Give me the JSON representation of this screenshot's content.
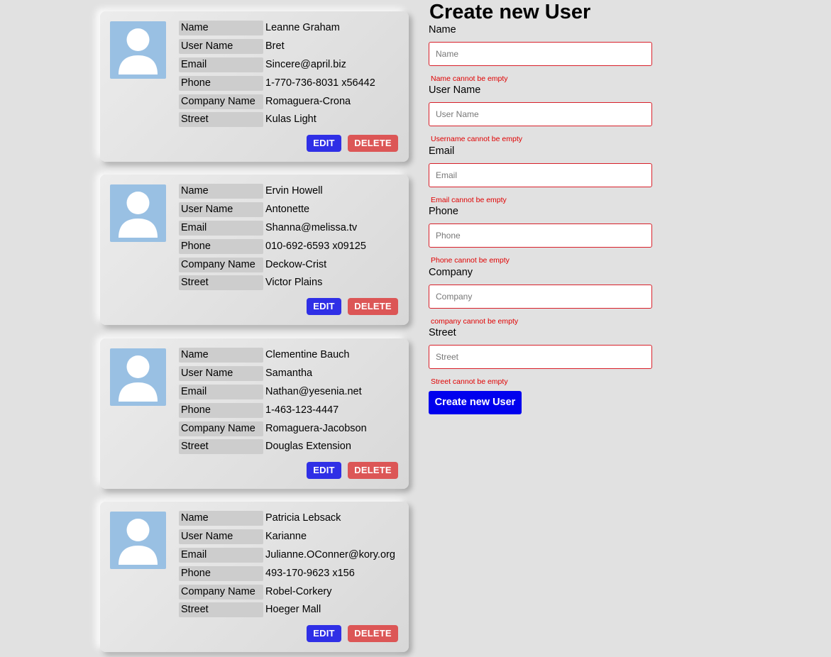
{
  "labels": {
    "name": "Name",
    "username": "User Name",
    "email": "Email",
    "phone": "Phone",
    "company": "Company Name",
    "street": "Street",
    "edit": "EDIT",
    "delete": "DELETE"
  },
  "users": [
    {
      "name": "Leanne Graham",
      "username": "Bret",
      "email": "Sincere@april.biz",
      "phone": "1-770-736-8031 x56442",
      "company": "Romaguera-Crona",
      "street": "Kulas Light"
    },
    {
      "name": "Ervin Howell",
      "username": "Antonette",
      "email": "Shanna@melissa.tv",
      "phone": "010-692-6593 x09125",
      "company": "Deckow-Crist",
      "street": "Victor Plains"
    },
    {
      "name": "Clementine Bauch",
      "username": "Samantha",
      "email": "Nathan@yesenia.net",
      "phone": "1-463-123-4447",
      "company": "Romaguera-Jacobson",
      "street": "Douglas Extension"
    },
    {
      "name": "Patricia Lebsack",
      "username": "Karianne",
      "email": "Julianne.OConner@kory.org",
      "phone": "493-170-9623 x156",
      "company": "Robel-Corkery",
      "street": "Hoeger Mall"
    }
  ],
  "form": {
    "title": "Create new User",
    "fields": [
      {
        "label": "Name",
        "placeholder": "Name",
        "value": "",
        "error": "Name cannot be empty"
      },
      {
        "label": "User Name",
        "placeholder": "User Name",
        "value": "",
        "error": "Username cannot be empty"
      },
      {
        "label": "Email",
        "placeholder": "Email",
        "value": "",
        "error": "Email cannot be empty"
      },
      {
        "label": "Phone",
        "placeholder": "Phone",
        "value": "",
        "error": "Phone cannot be empty"
      },
      {
        "label": "Company",
        "placeholder": "Company",
        "value": "",
        "error": "company cannot be empty"
      },
      {
        "label": "Street",
        "placeholder": "Street",
        "value": "",
        "error": "Street cannot be empty"
      }
    ],
    "submit_label": "Create new User"
  },
  "icons": {
    "avatar": "user-avatar-icon"
  },
  "colors": {
    "edit_button": "#2f2fe6",
    "delete_button": "#dc5656",
    "submit_button": "#0000ee",
    "error": "#e00000",
    "avatar_bg": "#99c0e3"
  }
}
